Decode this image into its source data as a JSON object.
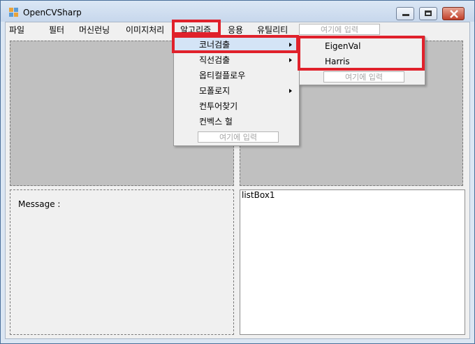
{
  "window": {
    "title": "OpenCVSharp"
  },
  "menubar": {
    "items": [
      "파일",
      "필터",
      "머신런닝",
      "이미지처리",
      "알고리즘",
      "응용",
      "유틸리티"
    ],
    "input_placeholder": "여기에 입력"
  },
  "algorithm_menu": {
    "items": [
      {
        "label": "코너검출",
        "submenu": true
      },
      {
        "label": "직선검출",
        "submenu": true
      },
      {
        "label": "옵티컬플로우",
        "submenu": false
      },
      {
        "label": "모폴로지",
        "submenu": true
      },
      {
        "label": "컨투어찾기",
        "submenu": false
      },
      {
        "label": "컨벡스 헐",
        "submenu": false
      }
    ],
    "input_placeholder": "여기에 입력"
  },
  "corner_submenu": {
    "items": [
      "EigenVal",
      "Harris"
    ],
    "input_placeholder": "여기에 입력"
  },
  "panels": {
    "message_label": "Message :",
    "listbox_label": "listBox1"
  },
  "colors": {
    "highlight": "#e0212b",
    "picture_bg": "#c0c0c0"
  }
}
